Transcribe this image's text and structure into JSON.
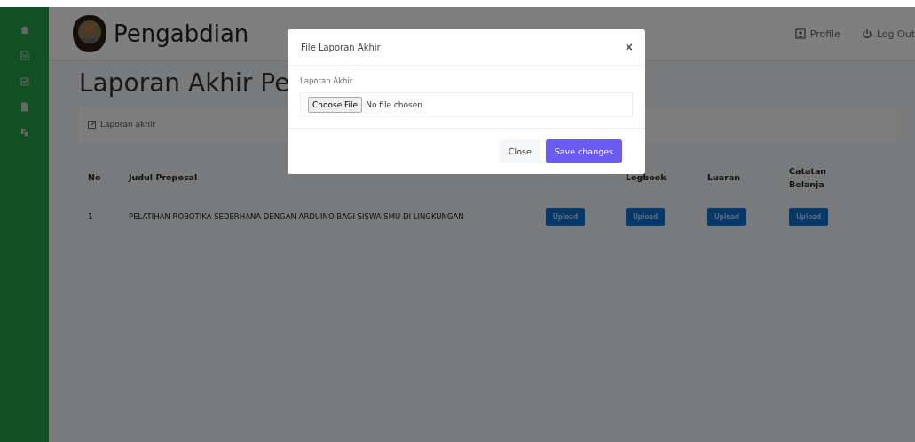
{
  "sidebar": {
    "items": [
      {
        "kind": "home"
      },
      {
        "kind": "document"
      },
      {
        "kind": "check"
      },
      {
        "kind": "file"
      },
      {
        "kind": "copy"
      }
    ]
  },
  "header": {
    "title": "Pengabdian",
    "links": [
      {
        "kind": "profile",
        "label": "Profile"
      },
      {
        "kind": "power",
        "label": "Log Out"
      }
    ]
  },
  "page": {
    "title": "Laporan Akhir Pe",
    "breadcrumb": "Laporan akhir"
  },
  "table": {
    "columns": [
      "No",
      "Judul Proposal",
      null,
      "Logbook",
      "Luaran",
      "Catatan Belanja"
    ],
    "rows": [
      {
        "no": "1",
        "title": "PELATIHAN ROBOTIKA SEDERHANA DENGAN ARDUINO BAGI SISWA SMU DI LINGKUNGAN",
        "buttons": [
          "Upload",
          "Upload",
          "Upload",
          "Upload"
        ]
      }
    ]
  },
  "modal": {
    "title": "File Laporan Akhir",
    "close_icon": "×",
    "field_label": "Laporan Akhir",
    "file_button": "Choose File",
    "file_status": "No file chosen",
    "buttons": [
      {
        "kind": "secondary",
        "label": "Close"
      },
      {
        "kind": "primary",
        "label": "Save changes"
      }
    ]
  }
}
